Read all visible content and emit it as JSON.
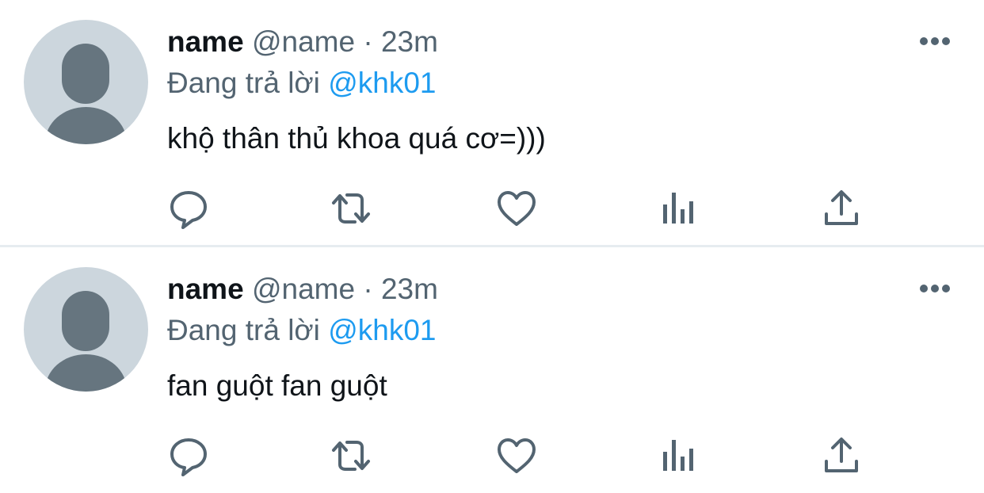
{
  "tweets": [
    {
      "name": "name",
      "handle": "@name",
      "separator": "·",
      "time": "23m",
      "reply_prefix": "Đang trả lời",
      "reply_mention": "@khk01",
      "text": "khộ thân thủ khoa quá cơ=)))"
    },
    {
      "name": "name",
      "handle": "@name",
      "separator": "·",
      "time": "23m",
      "reply_prefix": "Đang trả lời",
      "reply_mention": "@khk01",
      "text": "fan guột fan guột"
    }
  ],
  "icons": {
    "more": "more-horizontal-icon",
    "reply": "reply-bubble-icon",
    "retweet": "retweet-icon",
    "like": "heart-icon",
    "analytics": "analytics-bars-icon",
    "share": "share-upload-icon"
  },
  "colors": {
    "text_primary": "#0f1419",
    "text_secondary": "#536471",
    "link": "#1d9bf0",
    "avatar_bg": "#ccd6dd",
    "avatar_fg": "#66757f",
    "divider": "#e6ecf0"
  }
}
